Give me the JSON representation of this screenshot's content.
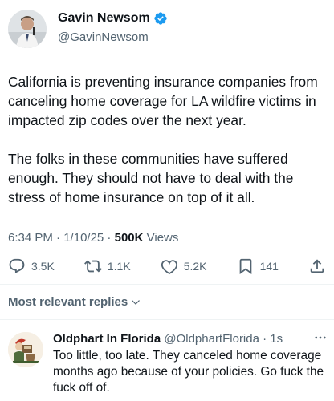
{
  "author": {
    "name": "Gavin Newsom",
    "handle": "@GavinNewsom",
    "verified": true
  },
  "tweet": {
    "text": "California is preventing insurance companies from canceling home coverage for LA wildfire victims in impacted zip codes over the next year.\n\nThe folks in these communities have suffered enough. They should not have to deal with the stress of home insurance on top of it all.",
    "time": "6:34 PM",
    "date": "1/10/25",
    "views_count": "500K",
    "views_label": "Views"
  },
  "actions": {
    "replies": "3.5K",
    "reposts": "1.1K",
    "likes": "5.2K",
    "bookmarks": "141"
  },
  "replies_sort": {
    "label": "Most relevant replies"
  },
  "reply": {
    "name": "Oldphart In Florida",
    "handle": "@OldphartFlorida",
    "time": "1s",
    "text": "Too little, too late. They canceled home coverage months ago because of your policies. Go fuck the fuck off of."
  },
  "colors": {
    "primary_text": "#0f1419",
    "secondary_text": "#536471",
    "verified_blue": "#1d9bf0",
    "divider": "#eff3f4"
  }
}
